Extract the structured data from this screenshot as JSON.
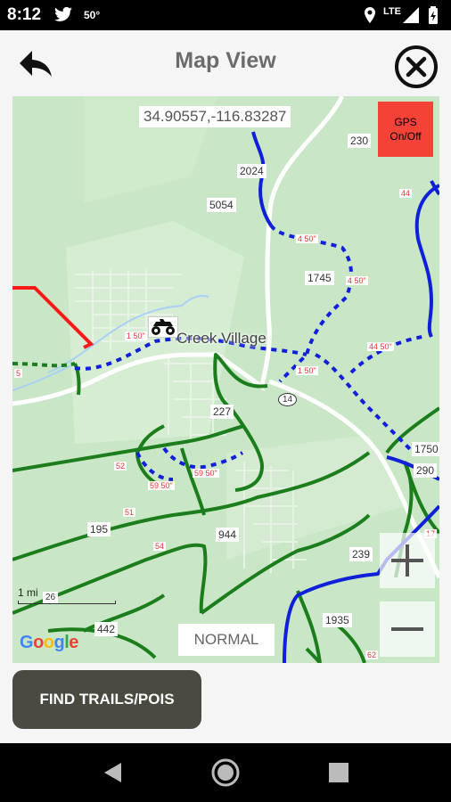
{
  "status_bar": {
    "time": "8:12",
    "temperature": "50°",
    "network": "LTE",
    "icons": [
      "twitter-icon",
      "location-icon",
      "signal-icon",
      "battery-icon"
    ]
  },
  "app_bar": {
    "title": "Map View",
    "back_icon": "back-arrow-icon",
    "close_icon": "close-circle-icon"
  },
  "map": {
    "coordinates": "34.90557,-116.83287",
    "gps_button": "GPS On/Off",
    "map_type_button": "NORMAL",
    "scale_label": "1 mi",
    "attribution": "Google",
    "place_name": "Creek Village",
    "route_labels": [
      "230",
      "2024",
      "5054",
      "1745",
      "227",
      "14",
      "1750",
      "290",
      "195",
      "944",
      "239",
      "442",
      "1935",
      "26"
    ],
    "trail_labels": [
      "44",
      "4 50\"",
      "4 50\"",
      "44 50\"",
      "1 50\"",
      "1 50\"",
      "5",
      "52",
      "59 50\"",
      "59 50\"",
      "51",
      "54",
      "17",
      "62"
    ],
    "zoom_in": "zoom-in-icon",
    "zoom_out": "zoom-out-icon",
    "colors": {
      "land": "#c9e7c6",
      "trail_green": "#1b7d1b",
      "trail_blue": "#1020d8",
      "trail_red": "#ff1a1a",
      "gps_button": "#f44336"
    }
  },
  "actions": {
    "find_button": "FIND TRAILS/POIS"
  },
  "nav_bar": {
    "icons": [
      "nav-back-icon",
      "nav-home-icon",
      "nav-recents-icon"
    ]
  }
}
